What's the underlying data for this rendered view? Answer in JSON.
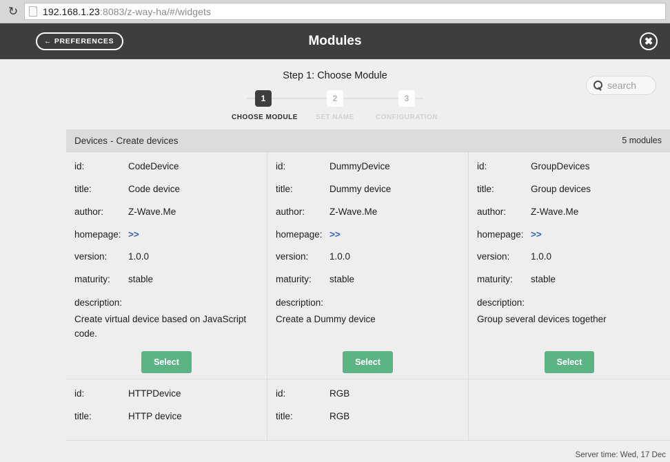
{
  "browser": {
    "reload_icon": "reload-icon",
    "page_icon": "document-icon",
    "url_host": "192.168.1.23",
    "url_path": ":8083/z-way-ha/#/widgets"
  },
  "header": {
    "preferences_label": "← PREFERENCES",
    "title": "Modules",
    "close_icon": "✖"
  },
  "wizard": {
    "step_title": "Step 1: Choose Module",
    "steps": [
      {
        "num": "1",
        "label": "CHOOSE MODULE",
        "active": true
      },
      {
        "num": "2",
        "label": "SET NAME",
        "active": false
      },
      {
        "num": "3",
        "label": "CONFIGURATION",
        "active": false
      }
    ]
  },
  "search": {
    "placeholder": "search",
    "value": "",
    "icon": "magnifier-icon"
  },
  "panel": {
    "category": "Devices",
    "separator": "-",
    "subtitle": "Create devices",
    "count": "5 modules"
  },
  "labels": {
    "id": "id:",
    "title": "title:",
    "author": "author:",
    "homepage": "homepage:",
    "version": "version:",
    "maturity": "maturity:",
    "description": "description:",
    "homepage_link": ">>",
    "select": "Select"
  },
  "modules": [
    {
      "id": "CodeDevice",
      "title": "Code device",
      "author": "Z-Wave.Me",
      "homepage": ">>",
      "version": "1.0.0",
      "maturity": "stable",
      "description": "Create virtual device based on JavaScript code."
    },
    {
      "id": "DummyDevice",
      "title": "Dummy device",
      "author": "Z-Wave.Me",
      "homepage": ">>",
      "version": "1.0.0",
      "maturity": "stable",
      "description": "Create a Dummy device"
    },
    {
      "id": "GroupDevices",
      "title": "Group devices",
      "author": "Z-Wave.Me",
      "homepage": ">>",
      "version": "1.0.0",
      "maturity": "stable",
      "description": "Group several devices together"
    },
    {
      "id": "HTTPDevice",
      "title": "HTTP device"
    },
    {
      "id": "RGB",
      "title": "RGB"
    }
  ],
  "footer": {
    "server_time": "Server time: Wed, 17 Dec"
  }
}
